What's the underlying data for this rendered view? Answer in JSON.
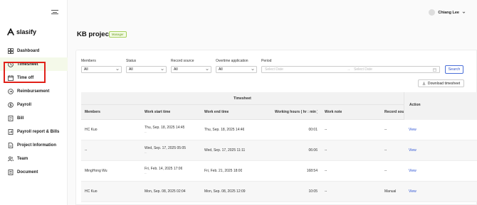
{
  "brand": {
    "name": "slasify"
  },
  "user": {
    "name": "Chiang Lee"
  },
  "sidebar": {
    "items": [
      {
        "label": "Dashboard",
        "icon": "dashboard-icon"
      },
      {
        "label": "Timesheet",
        "icon": "clock-icon"
      },
      {
        "label": "Time off",
        "icon": "calendar-icon"
      },
      {
        "label": "Reimbursement",
        "icon": "reimbursement-icon"
      },
      {
        "label": "Payroll",
        "icon": "payroll-icon"
      },
      {
        "label": "Bill",
        "icon": "bill-icon"
      },
      {
        "label": "Payroll report & Bills",
        "icon": "report-icon"
      },
      {
        "label": "Project Information",
        "icon": "document-icon"
      },
      {
        "label": "Team",
        "icon": "team-icon"
      },
      {
        "label": "Document",
        "icon": "folder-icon"
      }
    ],
    "active": "Timesheet"
  },
  "page": {
    "title": "KB project",
    "role_badge": "Manager"
  },
  "filters": {
    "members": {
      "label": "Members",
      "value": "All"
    },
    "status": {
      "label": "Status",
      "value": "All"
    },
    "record_source": {
      "label": "Record source",
      "value": "All"
    },
    "overtime": {
      "label": "Overtime application",
      "value": "All"
    },
    "period": {
      "label": "Period",
      "start_placeholder": "Select Date",
      "separator": "→",
      "end_placeholder": "Select Date"
    },
    "search_label": "Search"
  },
  "download_label": "Download timesheet",
  "table": {
    "group_title": "Timesheet",
    "headers": {
      "members": "Members",
      "start": "Work start time",
      "end": "Work end time",
      "hours": "Working hours ( hr : min )",
      "note": "Work note",
      "source": "Record source",
      "action": "Action"
    },
    "rows": [
      {
        "member": "HC Kuo",
        "start": "Thu, Sep. 18, 2025 14:45",
        "start_sub": "--",
        "end": "Thu, Sep. 18, 2025 14:46",
        "hours": "00:01",
        "note": "--",
        "source": "--",
        "action": "View"
      },
      {
        "member": "--",
        "start": "Wed, Sep. 17, 2025 05:05",
        "start_sub": "--",
        "end": "Wed, Sep. 17, 2025 11:11",
        "hours": "06:06",
        "note": "--",
        "source": "--",
        "action": "View"
      },
      {
        "member": "MingHong Wu",
        "start": "Fri, Feb. 14, 2025 17:06",
        "start_sub": "--",
        "end": "Fri, Feb. 21, 2025 18:00",
        "hours": "168:54",
        "note": "--",
        "source": "--",
        "action": "View"
      },
      {
        "member": "HC Kuo",
        "start": "Mon, Sep. 08, 2025 02:04",
        "start_sub": "",
        "end": "Mon, Sep. 08, 2025 12:09",
        "hours": "10:05",
        "note": "--",
        "source": "Manual",
        "action": "View"
      }
    ]
  },
  "colors": {
    "accent": "#6b9b1e",
    "link": "#2f55d4",
    "highlight": "#e02018"
  }
}
